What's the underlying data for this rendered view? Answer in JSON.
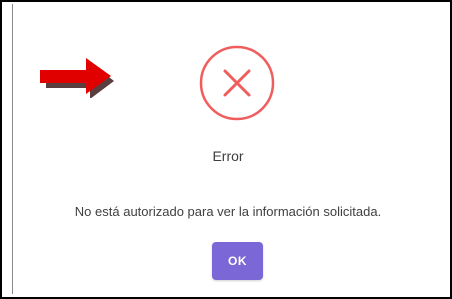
{
  "dialog": {
    "title": "Error",
    "message": "No está autorizado para ver la información solicitada.",
    "ok_label": "OK",
    "icon": "error-x-circle-icon",
    "accent_color": "#7b68d6",
    "icon_color": "#f05d5d"
  },
  "annotation": {
    "arrow_icon": "red-arrow-right-icon",
    "arrow_color": "#e00000"
  }
}
